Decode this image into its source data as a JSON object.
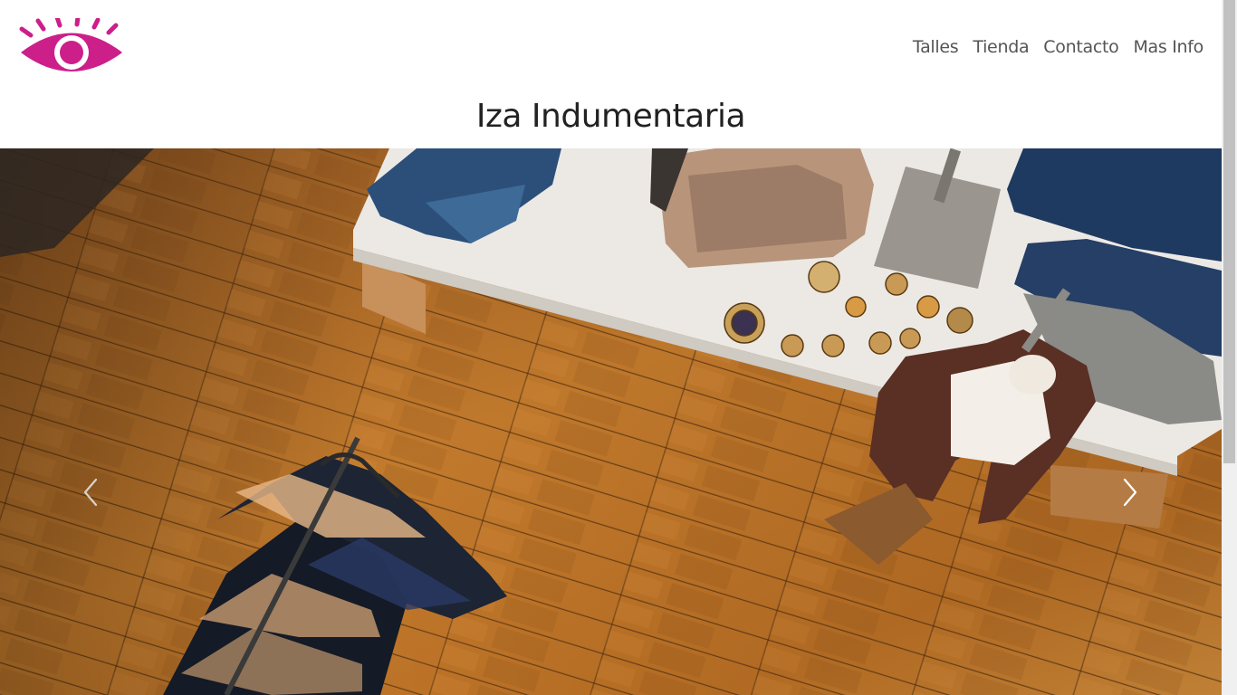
{
  "brand": {
    "logo_icon": "eye-icon",
    "logo_color": "#cc1f8a"
  },
  "nav": {
    "items": [
      {
        "label": "Talles"
      },
      {
        "label": "Tienda"
      },
      {
        "label": "Contacto"
      },
      {
        "label": "Mas Info"
      }
    ]
  },
  "hero": {
    "title": "Iza Indumentaria",
    "prev_icon": "chevron-left-icon",
    "next_icon": "chevron-right-icon"
  },
  "colors": {
    "accent": "#cc1f8a",
    "nav_text": "#555555",
    "title_text": "#222222"
  }
}
